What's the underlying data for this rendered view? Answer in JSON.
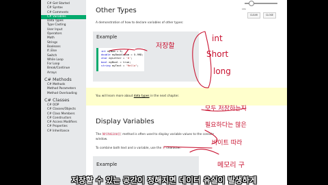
{
  "sidebar": {
    "items_top": [
      "C# Get Started",
      "C# Syntax",
      "C# Comments",
      "C# Variables",
      "Data Types",
      "Type Casting",
      "User Input",
      "Operators",
      "Math",
      "Strings",
      "Booleans",
      "If..Else",
      "Switch",
      "While Loop",
      "For Loop",
      "Break/Continue",
      "Arrays"
    ],
    "section_methods": "C# Methods",
    "items_methods": [
      "C# Methods",
      "Method Parameters",
      "Method Overloading"
    ],
    "section_classes": "C# Classes",
    "items_classes": [
      "C# OOP",
      "C# Classes/Objects",
      "C# Class Members",
      "C# Constructors",
      "C# Access Modifiers",
      "C# Properties",
      "C# Inheritance"
    ]
  },
  "main": {
    "title_other_types": "Other Types",
    "desc_other_types": "A demonstration of how to declare variables of other types:",
    "example_label": "Example",
    "code": [
      {
        "kw": "int",
        "rest": " myNum = 5;"
      },
      {
        "kw": "double",
        "rest": " myDoubleNum = 5.99D;"
      },
      {
        "kw": "char",
        "rest": " myLetter = ",
        "str": "'D'",
        "end": ";"
      },
      {
        "kw": "bool",
        "rest": " myBool = true;"
      },
      {
        "kw": "string",
        "rest": " myText = ",
        "str": "\"Hello\"",
        "end": ";"
      }
    ],
    "note_prefix": "You will learn more about ",
    "note_link": "data types",
    "note_suffix": " in the next chapter.",
    "title_display": "Display Variables",
    "desc_display_1a": "The ",
    "desc_display_code": "WriteLine()",
    "desc_display_1b": " method is often used to display variable values to the console",
    "desc_display_2": "window.",
    "desc_display_3a": "To combine both text and a variable, use the ",
    "desc_display_3b": "+",
    "desc_display_3c": " character:",
    "example_label_2": "Example"
  },
  "controls": {
    "label": "size",
    "btn_left": "CLEAR",
    "btn_right": "CLOSE"
  },
  "annotations": {
    "a1": "저장할",
    "a2": "int",
    "a3": "Short",
    "a4": "long",
    "a5": "모두 저장하는지",
    "a6": "필요하다는 많은",
    "a7": "바이트 따라",
    "a8": "메모리 구"
  },
  "subtitle": "저장할 수 있는 공간이 정해지면 데이터 유실이 발생하게"
}
